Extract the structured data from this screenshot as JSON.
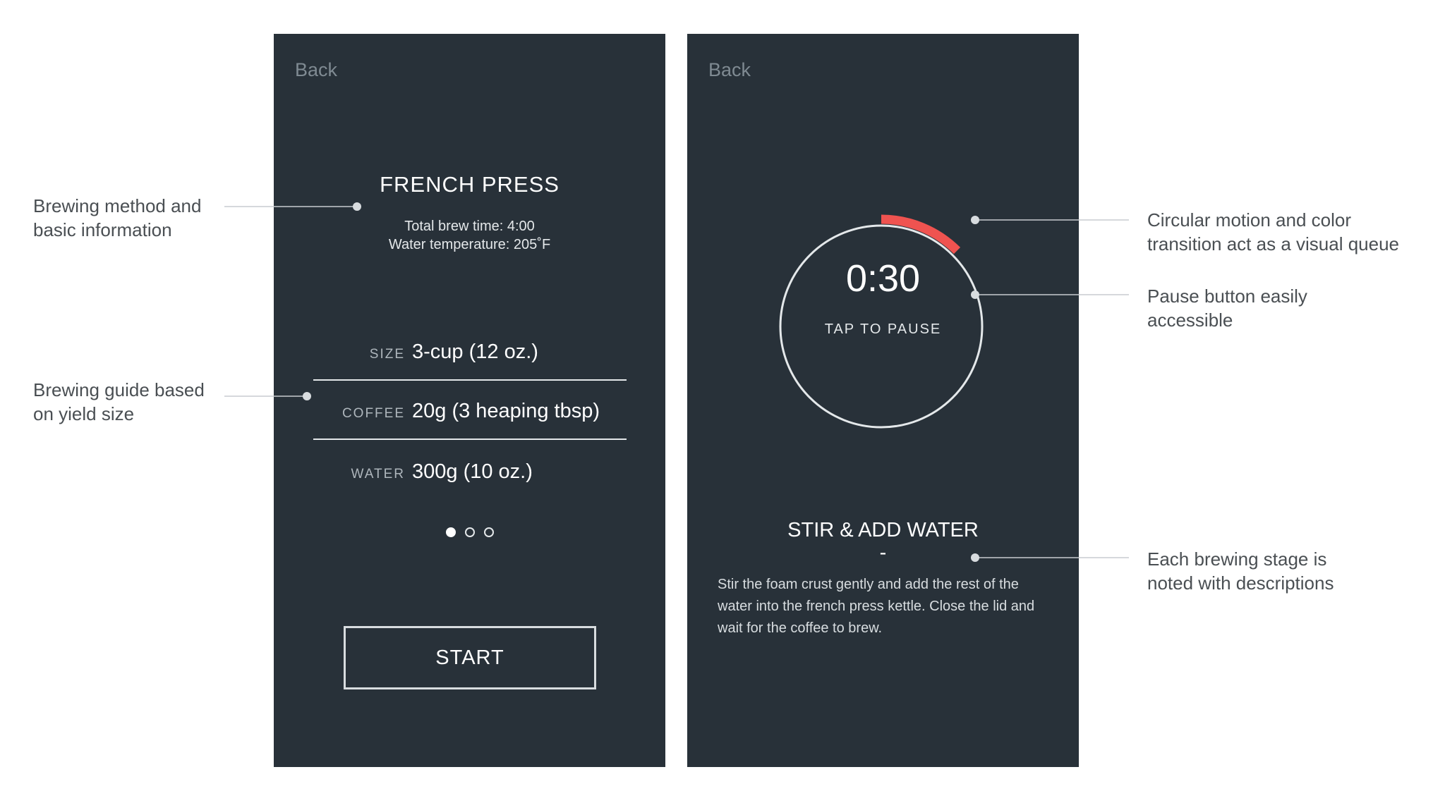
{
  "phone_setup": {
    "back_label": "Back",
    "method_title": "FRENCH PRESS",
    "brew_time": "Total brew time: 4:00",
    "water_temp": "Water temperature: 205˚F",
    "guide": [
      {
        "label": "SIZE",
        "value": "3-cup (12 oz.)"
      },
      {
        "label": "COFFEE",
        "value": "20g (3 heaping tbsp)"
      },
      {
        "label": "WATER",
        "value": "300g (10 oz.)"
      }
    ],
    "page_indicator": {
      "total": 3,
      "current": 1
    },
    "start_label": "START"
  },
  "phone_timer": {
    "back_label": "Back",
    "timer_value": "0:30",
    "tap_label": "TAP TO PAUSE",
    "progress_fraction": 0.125,
    "stage_title": "STIR & ADD WATER",
    "stage_separator": "-",
    "stage_description": "Stir the foam crust gently and add the rest of the water into the french press kettle. Close the lid and wait for the coffee to brew."
  },
  "annotations": {
    "method": {
      "line1": "Brewing method and",
      "line2": "basic information"
    },
    "guide": {
      "line1": "Brewing guide based",
      "line2": "on yield size"
    },
    "circular": {
      "line1": "Circular motion and color",
      "line2": "transition act as a visual queue"
    },
    "pause": {
      "line1": "Pause button easily",
      "line2": "accessible"
    },
    "stage": {
      "line1": "Each brewing stage is",
      "line2": "noted with descriptions"
    }
  },
  "colors": {
    "panel_background": "#283139",
    "progress_accent": "#ef5350",
    "annotation_text": "#4a4f53",
    "leader_line": "#c8ccd0"
  }
}
